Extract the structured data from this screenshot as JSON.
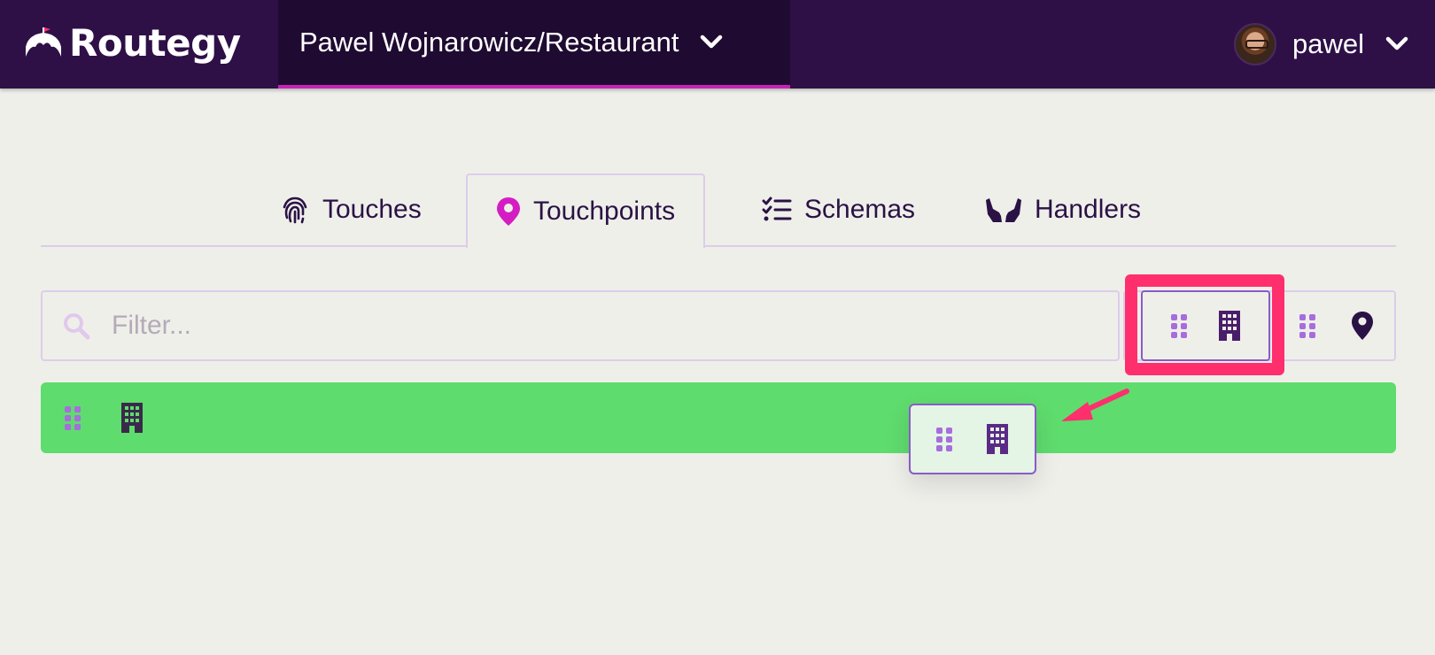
{
  "app": {
    "name": "Routegy"
  },
  "header": {
    "workspace": "Pawel Wojnarowicz/Restaurant",
    "user": "pawel"
  },
  "tabs": [
    {
      "label": "Touches",
      "icon": "fingerprint-icon",
      "active": false
    },
    {
      "label": "Touchpoints",
      "icon": "map-marker-icon",
      "active": true
    },
    {
      "label": "Schemas",
      "icon": "tasks-list-icon",
      "active": false
    },
    {
      "label": "Handlers",
      "icon": "hands-icon",
      "active": false
    }
  ],
  "filter": {
    "placeholder": "Filter...",
    "value": ""
  },
  "view_toggle": {
    "options": [
      {
        "icons": [
          "grip-icon",
          "building-icon"
        ],
        "selected": true
      },
      {
        "icons": [
          "grip-icon",
          "map-marker-icon"
        ],
        "selected": false
      }
    ]
  },
  "rows": [
    {
      "icons": [
        "grip-icon",
        "building-icon"
      ]
    }
  ],
  "drag_preview": {
    "icons": [
      "grip-icon",
      "building-icon"
    ]
  },
  "colors": {
    "topbar": "#2e1047",
    "workspace_bg": "#1f0a31",
    "accent": "#c523b7",
    "highlight": "#ff2f6e",
    "row_green": "#5fdc6e",
    "grip": "#a66ddd",
    "building": "#4a1d6b"
  }
}
